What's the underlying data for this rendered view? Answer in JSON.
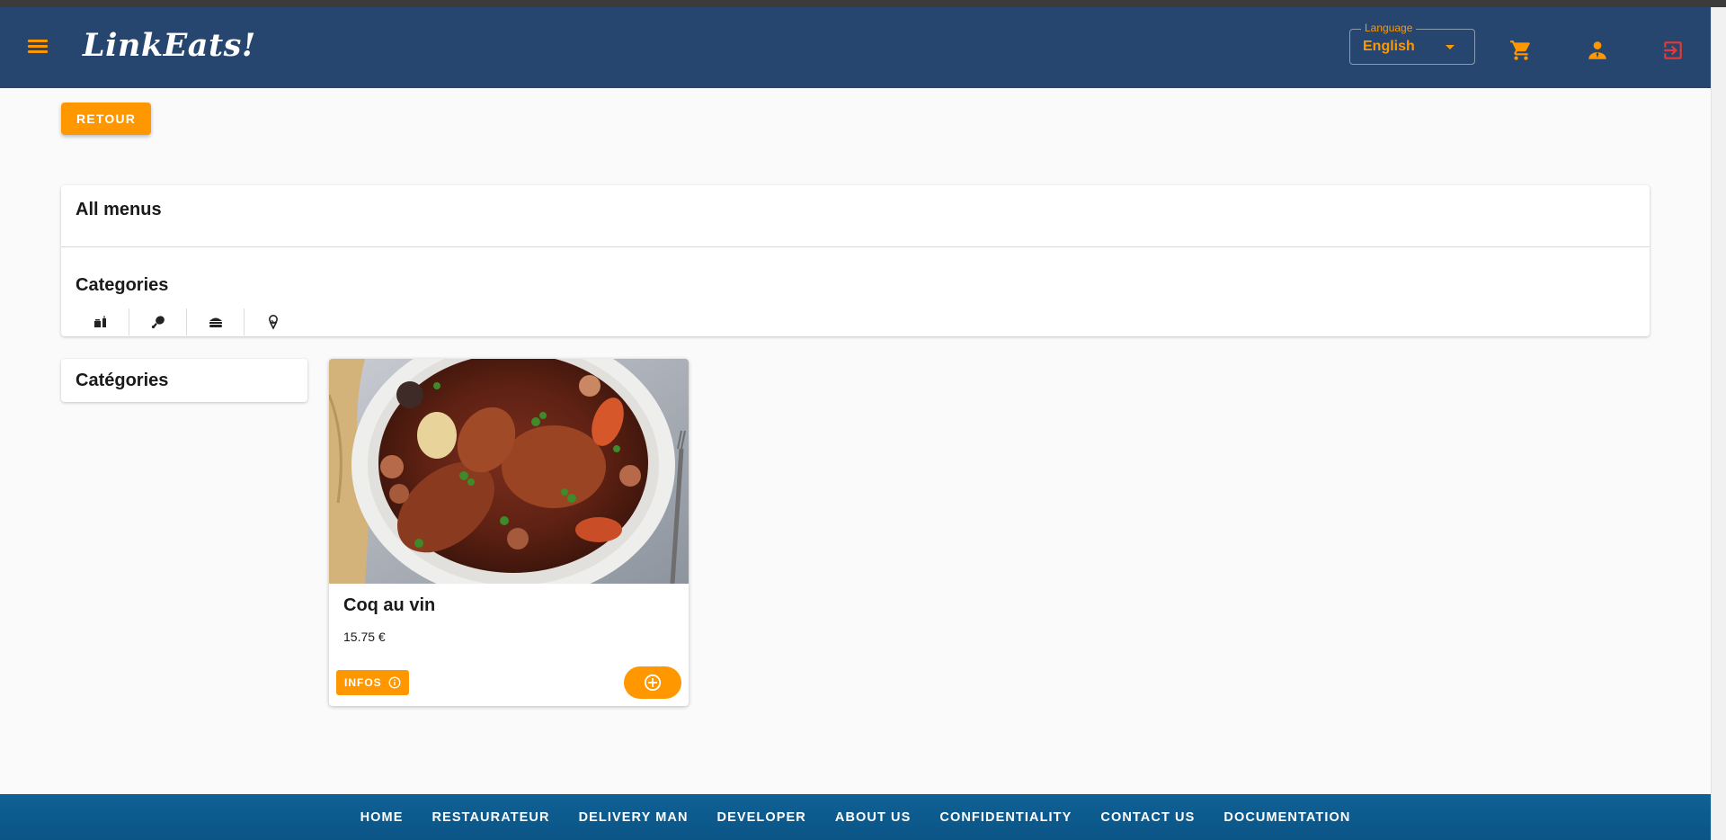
{
  "header": {
    "brand": "LinkEats!",
    "language": {
      "label": "Language",
      "value": "English"
    },
    "icons": [
      "menu-icon",
      "cart-icon",
      "user-icon",
      "logout-icon"
    ],
    "colors": {
      "bar": "#27466f",
      "accent": "#ff9800",
      "logout": "#e53935"
    }
  },
  "actions": {
    "back_label": "RETOUR"
  },
  "menus_panel": {
    "title": "All menus",
    "categories_title": "Categories",
    "category_icons": [
      "drink-icon",
      "drumstick-icon",
      "burger-icon",
      "ice-cream-icon"
    ]
  },
  "sidebar": {
    "title": "Catégories"
  },
  "dish": {
    "name": "Coq au vin",
    "price": "15.75 €",
    "infos_label": "INFOS",
    "icons": [
      "info-icon",
      "add-circle-icon"
    ]
  },
  "footer": {
    "links": [
      "HOME",
      "RESTAURATEUR",
      "DELIVERY MAN",
      "DEVELOPER",
      "ABOUT US",
      "CONFIDENTIALITY",
      "CONTACT US",
      "DOCUMENTATION"
    ],
    "color": "#0f6195"
  }
}
